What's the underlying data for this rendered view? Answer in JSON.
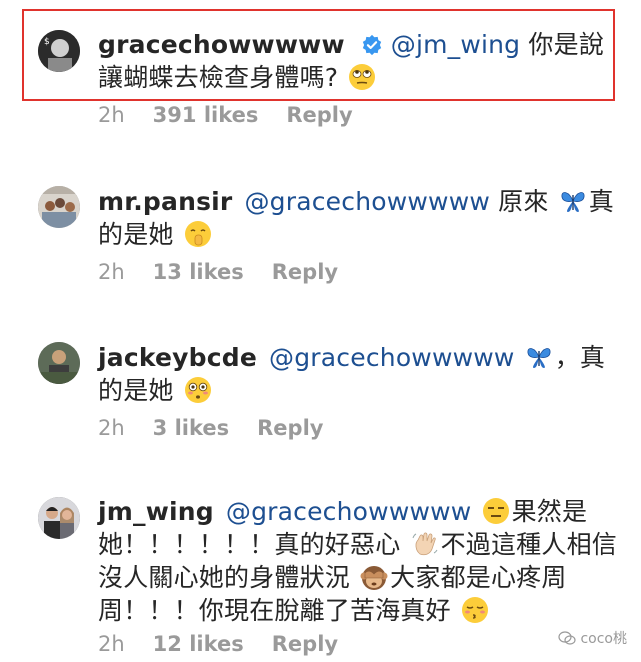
{
  "comments": [
    {
      "username": "gracechowwwww",
      "verified": true,
      "mention": "@jm_wing",
      "text_before_emoji": " 你是說讓蝴蝶去檢查身體嗎?",
      "text_after_emoji": "",
      "emoji": "eye-roll",
      "time": "2h",
      "likes": "391 likes",
      "reply": "Reply"
    },
    {
      "username": "mr.pansir",
      "mention": "@gracechowwwww",
      "text_before_emoji": " 原來",
      "emoji_mid": "butterfly",
      "text_mid": "真的是她",
      "emoji": "shushing-face",
      "time": "2h",
      "likes": "13 likes",
      "reply": "Reply"
    },
    {
      "username": "jackeybcde",
      "mention": "@gracechowwwww",
      "emoji_mid": "butterfly",
      "text_mid": "，真的是她",
      "emoji": "flushed-face",
      "time": "2h",
      "likes": "3 likes",
      "reply": "Reply"
    },
    {
      "username": "jm_wing",
      "mention": "@gracechowwwww",
      "emoji_1": "expressionless-face",
      "text_1": "果然是她！！！！！！真的好惡心",
      "emoji_2": "waving-hand",
      "text_2": "不過這種人相信沒人關心她的身體狀況",
      "emoji_3": "see-no-evil-monkey",
      "text_3": "大家都是心疼周周！！！你現在脫離了苦海真好",
      "emoji_4": "kissing-face",
      "time": "2h",
      "likes": "12 likes",
      "reply": "Reply"
    }
  ],
  "watermark": "coco桃"
}
